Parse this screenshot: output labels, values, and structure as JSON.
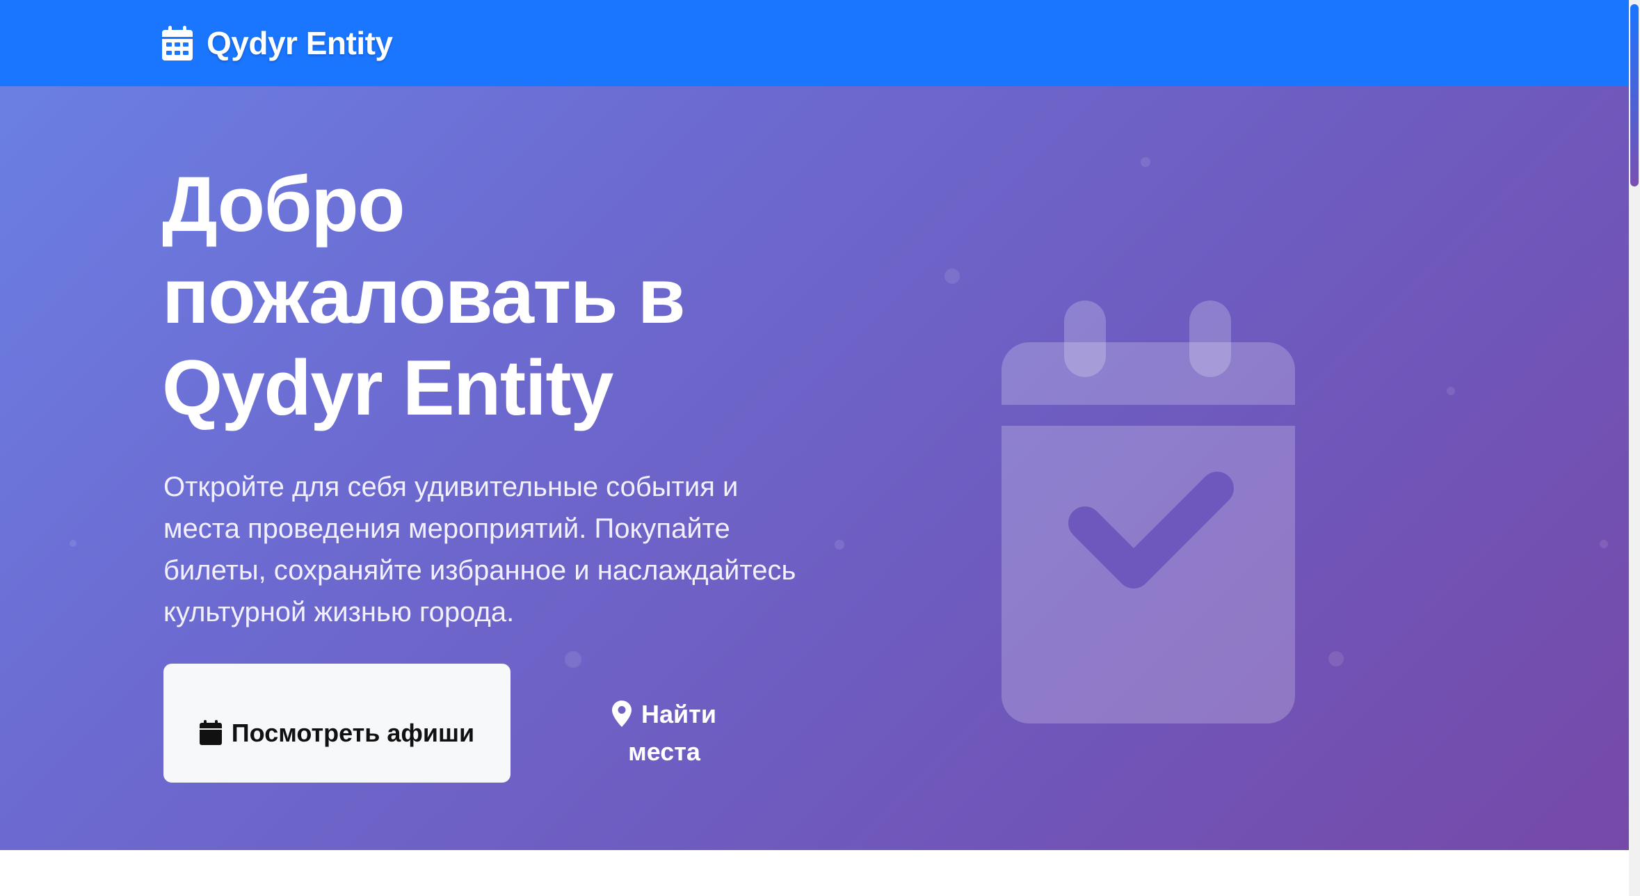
{
  "navbar": {
    "brand": "Qydyr Entity",
    "brand_icon": "calendar-icon",
    "background_color": "#1a75ff"
  },
  "hero": {
    "title": "Добро пожаловать в Qydyr Entity",
    "subtitle": "Откройте для себя удивительные события и места проведения мероприятий. Покупайте билеты, сохраняйте избранное и наслаждайтесь культурной жизнью города.",
    "gradient_colors": [
      "#6b7fe3",
      "#7549a8"
    ],
    "illustration_icon": "calendar-check-icon",
    "buttons": {
      "events": {
        "label": "Посмотреть афиши",
        "icon": "calendar-icon"
      },
      "places": {
        "label": "Найти места",
        "icon": "map-pin-icon"
      }
    }
  },
  "colors": {
    "primary": "#1a75ff",
    "button_bg": "#f7f8fa",
    "text_on_hero": "#ffffff"
  }
}
